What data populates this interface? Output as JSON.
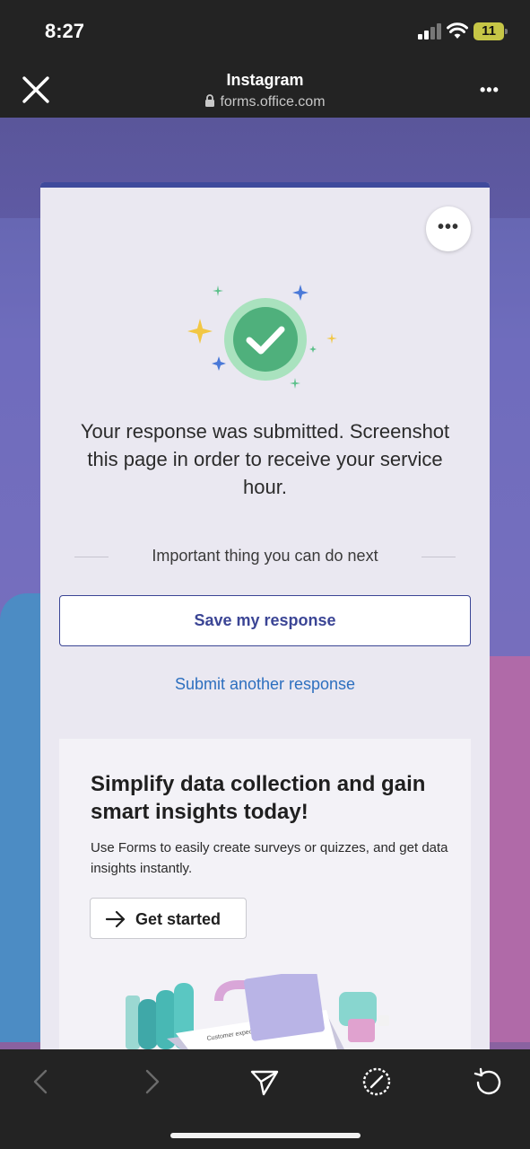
{
  "status_bar": {
    "time": "8:27",
    "battery": "11"
  },
  "browser": {
    "title": "Instagram",
    "url": "forms.office.com",
    "more": "•••"
  },
  "card": {
    "more": "•••",
    "confirmation": "Your response was submitted. Screenshot this page in order to receive your service hour.",
    "next_heading": "Important thing you can do next",
    "save_button": "Save my response",
    "another_link": "Submit another response"
  },
  "promo": {
    "title": "Simplify data collection and gain smart insights today!",
    "description": "Use Forms to easily create surveys or quizzes, and get data insights instantly.",
    "button": "Get started",
    "illustration_text": "Customer expectation survey"
  },
  "colors": {
    "accent": "#3b4595",
    "link": "#2d6fbf",
    "success_green": "#4fb07c",
    "background": "#6a62b2"
  },
  "icons": [
    "close-icon",
    "lock-icon",
    "more-icon",
    "checkmark-icon",
    "arrow-right-icon",
    "back-icon",
    "forward-icon",
    "share-icon",
    "compass-icon",
    "reload-icon"
  ]
}
